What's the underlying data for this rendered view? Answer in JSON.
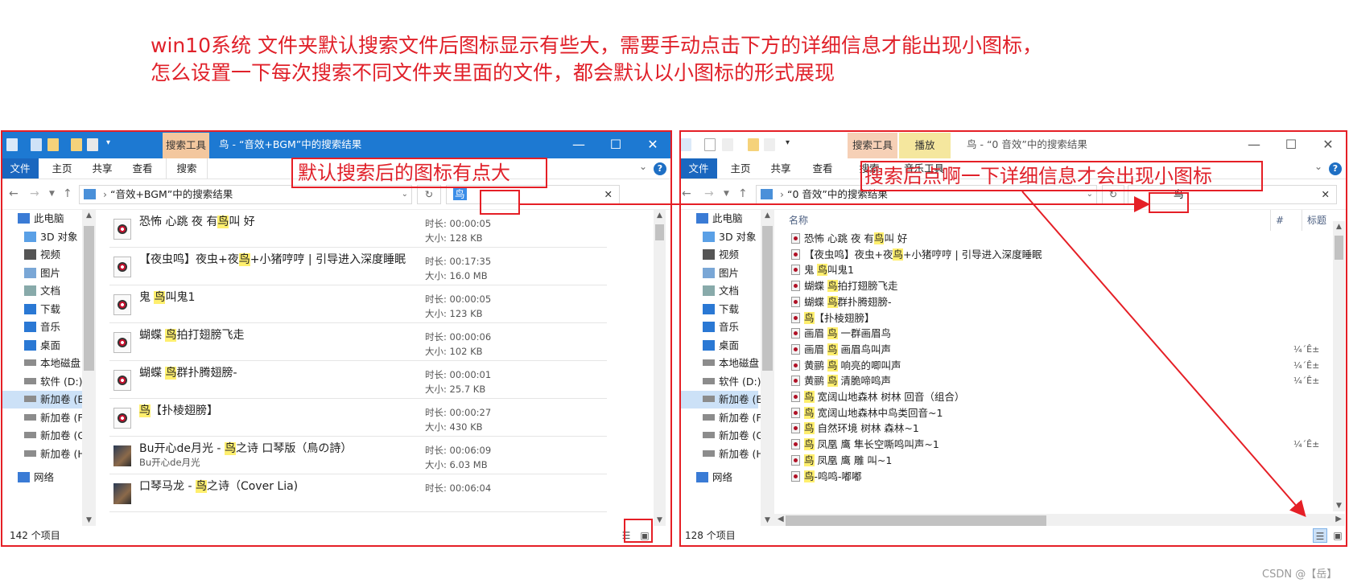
{
  "question": {
    "line1": "win10系统 文件夹默认搜索文件后图标显示有些大，需要手动点击下方的详细信息才能出现小图标，",
    "line2": "怎么设置一下每次搜索不同文件夹里面的文件，都会默认以小图标的形式展现"
  },
  "annotation_left": "默认搜索后的图标有点大",
  "annotation_right": "搜索后点啊一下详细信息才会出现小图标",
  "watermark": "CSDN @【岳】",
  "colors": {
    "accent_red": "#e51f26",
    "titlebar_blue": "#1d79d2",
    "highlight": "#ffef6e",
    "selection": "#cce1f7"
  },
  "left_window": {
    "context_tab": "搜索工具",
    "title": "鸟 - “音效+BGM”中的搜索结果",
    "ribbon_tabs": [
      "文件",
      "主页",
      "共享",
      "查看",
      "搜索"
    ],
    "address": "“音效+BGM”中的搜索结果",
    "search_text": "鸟",
    "status": "142 个项目",
    "tiles": [
      {
        "pre": "恐怖 心跳 夜 有",
        "hl": "鸟",
        "post": "叫 好",
        "duration": "时长: 00:00:05",
        "size": "大小: 128 KB",
        "sub": "",
        "photo": false
      },
      {
        "pre": "【夜虫鸣】夜虫+夜",
        "hl": "鸟",
        "post": "+小猪哼哼 | 引导进入深度睡眠",
        "duration": "时长: 00:17:35",
        "size": "大小: 16.0 MB",
        "sub": "",
        "photo": false
      },
      {
        "pre": "鬼 ",
        "hl": "鸟",
        "post": "叫鬼1",
        "duration": "时长: 00:00:05",
        "size": "大小: 123 KB",
        "sub": "",
        "photo": false
      },
      {
        "pre": "蝴蝶 ",
        "hl": "鸟",
        "post": "拍打翅膀飞走",
        "duration": "时长: 00:00:06",
        "size": "大小: 102 KB",
        "sub": "",
        "photo": false
      },
      {
        "pre": "蝴蝶 ",
        "hl": "鸟",
        "post": "群扑腾翅膀-",
        "duration": "时长: 00:00:01",
        "size": "大小: 25.7 KB",
        "sub": "",
        "photo": false
      },
      {
        "pre": "",
        "hl": "鸟",
        "post": "【扑棱翅膀】",
        "duration": "时长: 00:00:27",
        "size": "大小: 430 KB",
        "sub": "",
        "photo": false
      },
      {
        "pre": "Bu开心de月光 - ",
        "hl": "鸟",
        "post": "之诗 口琴版（鳥の詩）",
        "duration": "时长: 00:06:09",
        "size": "大小: 6.03 MB",
        "sub": "Bu开心de月光",
        "photo": true
      },
      {
        "pre": "口琴马龙 - ",
        "hl": "鸟",
        "post": "之诗（Cover Lia)",
        "duration": "时长: 00:06:04",
        "size": "",
        "sub": "",
        "photo": true
      }
    ]
  },
  "right_window": {
    "context_tab1": "搜索工具",
    "context_tab2": "播放",
    "title": "鸟 - “0 音效”中的搜索结果",
    "ribbon_tabs": [
      "文件",
      "主页",
      "共享",
      "查看",
      "搜索",
      "音乐工具"
    ],
    "address": "“0 音效”中的搜索结果",
    "search_text": "鸟",
    "status": "128 个项目",
    "columns": [
      "名称",
      "#",
      "标题"
    ],
    "rows": [
      {
        "pre": "恐怖 心跳 夜 有",
        "hl": "鸟",
        "post": "叫 好",
        "extra": ""
      },
      {
        "pre": "【夜虫鸣】夜虫+夜",
        "hl": "鸟",
        "post": "+小猪哼哼 | 引导进入深度睡眠",
        "extra": ""
      },
      {
        "pre": "鬼 ",
        "hl": "鸟",
        "post": "叫鬼1",
        "extra": ""
      },
      {
        "pre": "蝴蝶 ",
        "hl": "鸟",
        "post": "拍打翅膀飞走",
        "extra": ""
      },
      {
        "pre": "蝴蝶 ",
        "hl": "鸟",
        "post": "群扑腾翅膀-",
        "extra": ""
      },
      {
        "pre": "",
        "hl": "鸟",
        "post": "【扑棱翅膀】",
        "extra": ""
      },
      {
        "pre": "画眉 ",
        "hl": "鸟",
        "post": " 一群画眉鸟",
        "extra": ""
      },
      {
        "pre": "画眉 ",
        "hl": "鸟",
        "post": " 画眉鸟叫声",
        "extra": "¼´Ê±"
      },
      {
        "pre": "黄鹂 ",
        "hl": "鸟",
        "post": " 响亮的唧叫声",
        "extra": "¼´Ê±"
      },
      {
        "pre": "黄鹂 ",
        "hl": "鸟",
        "post": " 清脆啼鸣声",
        "extra": "¼´Ê±"
      },
      {
        "pre": "",
        "hl": "鸟",
        "post": " 宽阔山地森林 树林 回音（组合）",
        "extra": ""
      },
      {
        "pre": "",
        "hl": "鸟",
        "post": " 宽阔山地森林中鸟类回音~1",
        "extra": ""
      },
      {
        "pre": "",
        "hl": "鸟",
        "post": " 自然环境 树林 森林~1",
        "extra": ""
      },
      {
        "pre": "",
        "hl": "鸟",
        "post": " 凤凰 鹰 隼长空嘶鸣叫声~1",
        "extra": "¼´Ê±"
      },
      {
        "pre": "",
        "hl": "鸟",
        "post": " 凤凰 鹰 雕 叫~1",
        "extra": ""
      },
      {
        "pre": "",
        "hl": "鸟",
        "post": "-鸣鸣-嘟嘟",
        "extra": ""
      }
    ]
  },
  "sidebar": [
    {
      "label": "此电脑",
      "icon": "computer-icon"
    },
    {
      "label": "3D 对象",
      "icon": "3d-objects-icon"
    },
    {
      "label": "视频",
      "icon": "video-icon"
    },
    {
      "label": "图片",
      "icon": "pictures-icon"
    },
    {
      "label": "文档",
      "icon": "documents-icon"
    },
    {
      "label": "下载",
      "icon": "download-icon"
    },
    {
      "label": "音乐",
      "icon": "music-icon"
    },
    {
      "label": "桌面",
      "icon": "desktop-icon"
    },
    {
      "label": "本地磁盘 (",
      "icon": "drive-icon"
    },
    {
      "label": "软件 (D:)",
      "icon": "drive-icon"
    },
    {
      "label": "新加卷 (E:",
      "icon": "drive-icon"
    },
    {
      "label": "新加卷 (F:)",
      "icon": "drive-icon"
    },
    {
      "label": "新加卷 (G:",
      "icon": "drive-icon"
    },
    {
      "label": "新加卷 (H:",
      "icon": "drive-icon"
    },
    {
      "label": "网络",
      "icon": "network-icon"
    }
  ]
}
